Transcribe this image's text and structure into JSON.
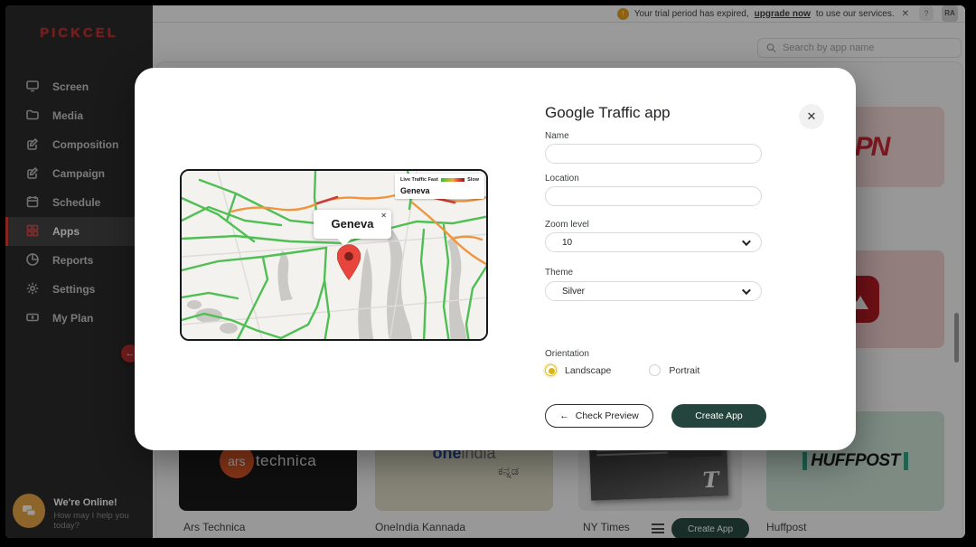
{
  "topbar": {
    "warning": {
      "prefix": "Your trial period has expired,",
      "link": "upgrade now",
      "suffix": "to use our services.",
      "close_icon": "✕",
      "icon_glyph": "!"
    },
    "help_label": "?",
    "avatar_initials": "RA"
  },
  "search": {
    "placeholder": "Search by app name"
  },
  "sidebar": {
    "logo": "PICKCEL",
    "items": [
      {
        "label": "Screen"
      },
      {
        "label": "Media"
      },
      {
        "label": "Composition"
      },
      {
        "label": "Campaign"
      },
      {
        "label": "Schedule"
      },
      {
        "label": "Apps"
      },
      {
        "label": "Reports"
      },
      {
        "label": "Settings"
      },
      {
        "label": "My Plan"
      }
    ],
    "active_item": "Apps",
    "collapse_icon": "←",
    "chat": {
      "title": "We're Online!",
      "subtitle": "How may I help you today?"
    }
  },
  "modal": {
    "title": "Google Traffic app",
    "close_icon": "✕",
    "name_label": "Name",
    "name_value": "",
    "location_label": "Location",
    "location_value": "",
    "zoom_label": "Zoom level",
    "zoom_value": "10",
    "theme_label": "Theme",
    "theme_value": "Silver",
    "orientation_label": "Orientation",
    "orientation_options": [
      {
        "label": "Landscape",
        "selected": true
      },
      {
        "label": "Portrait",
        "selected": false
      }
    ],
    "back_arrow": "←",
    "preview_button": "Check Preview",
    "create_button": "Create App",
    "map": {
      "legend_fast": "Live Traffic Fast",
      "legend_slow": "Slow",
      "legend_location": "Geneva",
      "infowindow_title": "Geneva",
      "infowindow_close": "✕"
    }
  },
  "apps_grid": {
    "espn_logo": "ESPN",
    "ars_badge": "ars",
    "ars_word": "technica",
    "ars_label": "Ars Technica",
    "oneindia_one": "one",
    "oneindia_india": "india",
    "oneindia_kannada": "ಕನ್ನಡ",
    "oneindia_label": "OneIndia Kannada",
    "nyt_t": "T",
    "nyt_label": "NY Times",
    "huffpost_logo": "HUFFPOST",
    "huffpost_label": "Huffpost",
    "create_app_button": "Create App"
  },
  "colors": {
    "accent_red": "#d32f2f",
    "create_button_green": "#24453d",
    "radio_selected_yellow": "#d9b514",
    "traffic_fast_green": "#3db33b",
    "traffic_slow_red": "#8f1d14",
    "chat_amber": "#e8a33d"
  }
}
